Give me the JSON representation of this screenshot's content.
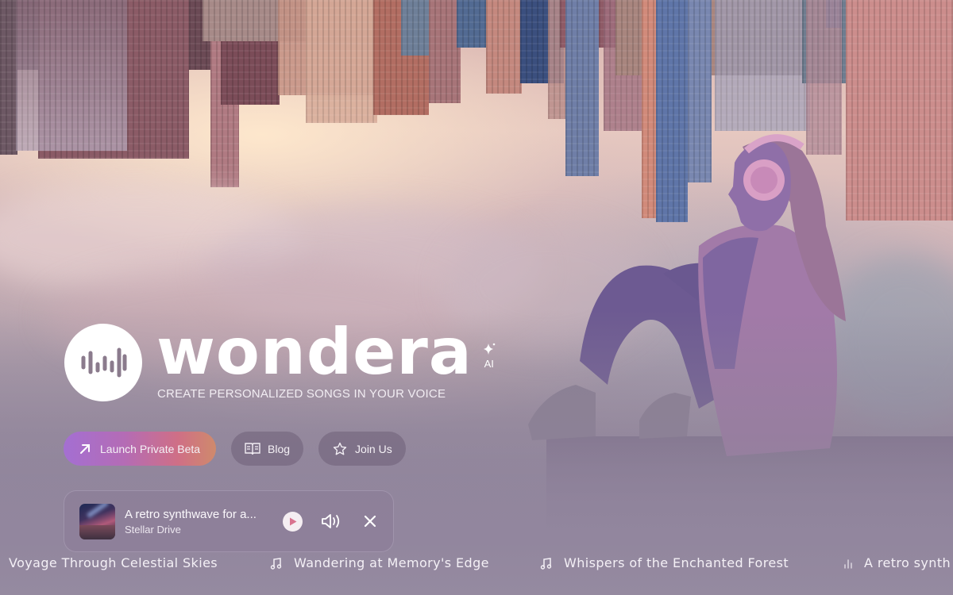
{
  "brand": {
    "name": "wondera",
    "badge_label": "AI",
    "tagline": "CREATE PERSONALIZED SONGS IN YOUR VOICE",
    "logo_icon": "audio-waveform-icon",
    "badge_icon": "sparkle-icon"
  },
  "actions": [
    {
      "label": "Launch Private Beta",
      "icon": "arrow-up-right-icon",
      "style": "primary"
    },
    {
      "label": "Blog",
      "icon": "book-open-icon",
      "style": "ghost"
    },
    {
      "label": "Join Us",
      "icon": "star-icon",
      "style": "ghost"
    }
  ],
  "player": {
    "title": "A retro synthwave for a...",
    "artist": "Stellar Drive",
    "cover_icon": "album-cover",
    "play_icon": "play-icon",
    "volume_icon": "volume-icon",
    "close_icon": "close-icon"
  },
  "marquee": [
    {
      "label": "Voyage Through Celestial Skies",
      "icon": "music-note-icon"
    },
    {
      "label": "Wandering at Memory's Edge",
      "icon": "music-note-icon"
    },
    {
      "label": "Whispers of the Enchanted Forest",
      "icon": "music-note-icon"
    },
    {
      "label": "A retro synth",
      "icon": "equalizer-icon"
    }
  ],
  "colors": {
    "primary_gradient_start": "#a46fd2",
    "primary_gradient_end": "#cf8a6c",
    "play_triangle": "#d9738f",
    "text": "#ffffff"
  }
}
